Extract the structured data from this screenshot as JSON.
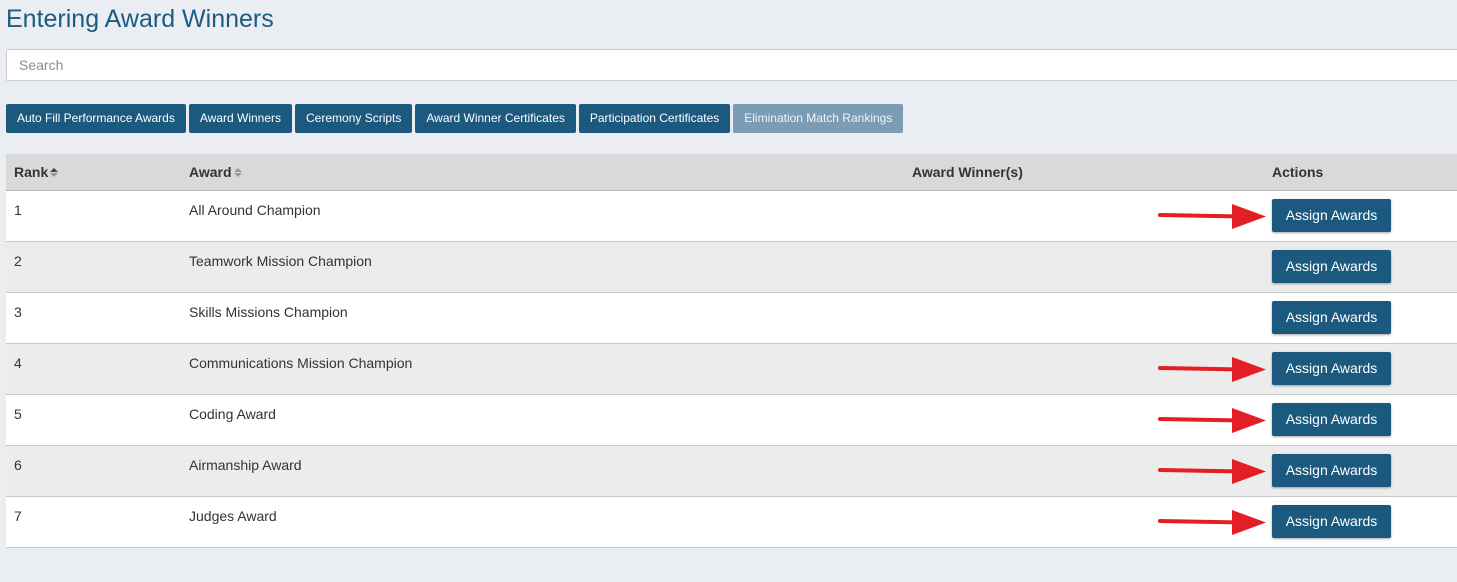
{
  "page": {
    "title": "Entering Award Winners"
  },
  "search": {
    "placeholder": "Search",
    "value": ""
  },
  "toolbar": {
    "buttons": [
      {
        "label": "Auto Fill Performance Awards"
      },
      {
        "label": "Award Winners"
      },
      {
        "label": "Ceremony Scripts"
      },
      {
        "label": "Award Winner Certificates"
      },
      {
        "label": "Participation Certificates"
      },
      {
        "label": "Elimination Match Rankings"
      }
    ]
  },
  "table": {
    "headers": {
      "rank": "Rank",
      "award": "Award",
      "winners": "Award Winner(s)",
      "actions": "Actions"
    },
    "rows": [
      {
        "rank": "1",
        "award": "All Around Champion",
        "winners": "",
        "action": "Assign Awards",
        "arrow": true
      },
      {
        "rank": "2",
        "award": "Teamwork Mission Champion",
        "winners": "",
        "action": "Assign Awards",
        "arrow": false
      },
      {
        "rank": "3",
        "award": "Skills Missions Champion",
        "winners": "",
        "action": "Assign Awards",
        "arrow": false
      },
      {
        "rank": "4",
        "award": "Communications Mission Champion",
        "winners": "",
        "action": "Assign Awards",
        "arrow": true
      },
      {
        "rank": "5",
        "award": "Coding Award",
        "winners": "",
        "action": "Assign Awards",
        "arrow": true
      },
      {
        "rank": "6",
        "award": "Airmanship Award",
        "winners": "",
        "action": "Assign Awards",
        "arrow": true
      },
      {
        "rank": "7",
        "award": "Judges Award",
        "winners": "",
        "action": "Assign Awards",
        "arrow": true
      }
    ]
  },
  "colors": {
    "accent": "#1b5a7e",
    "title": "#1d5c82",
    "annotation_arrow": "#e31e24"
  },
  "icons": {
    "sort": "sort-icon",
    "annotation": "red-arrow-icon"
  }
}
